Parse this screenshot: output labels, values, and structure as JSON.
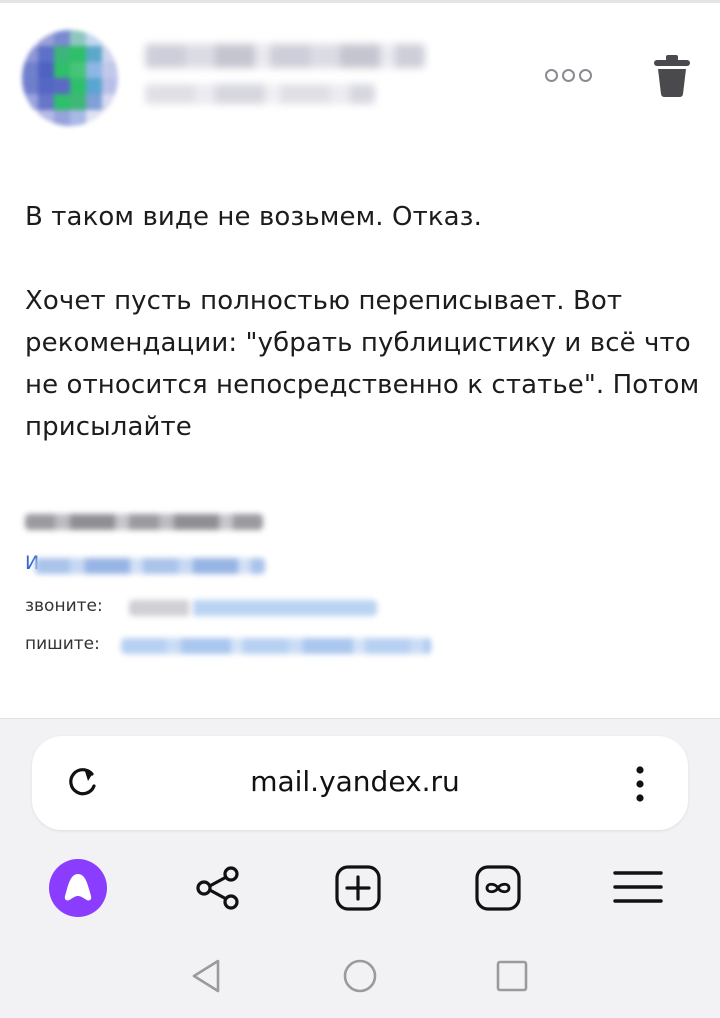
{
  "email": {
    "message_lines": [
      "В таком виде не возьмем. Отказ.",
      "Хочет пусть полностью переписывает. Вот рекомендации: \"убрать публицистику и всё что не относится непосредственно к статье\". Потом присылайте"
    ],
    "signature": {
      "link_prefix": "И",
      "phone_label": "звоните:",
      "mail_label": "пишите:"
    }
  },
  "browser": {
    "url": "mail.yandex.ru"
  },
  "icons": {
    "more": "more-horizontal-icon",
    "trash": "trash-icon",
    "reload": "reload-icon",
    "url_menu": "kebab-menu-icon",
    "alice": "alice-assistant-icon",
    "share": "share-icon",
    "new_tab": "plus-square-icon",
    "tabs": "tabs-infinity-icon",
    "menu": "hamburger-menu-icon",
    "sys_back": "triangle-back-icon",
    "sys_home": "circle-home-icon",
    "sys_recent": "square-recent-icon"
  },
  "colors": {
    "alice_purple": "#8b3dff",
    "link_blue": "#3366cc",
    "avatar_green": "#2fbf6a"
  }
}
